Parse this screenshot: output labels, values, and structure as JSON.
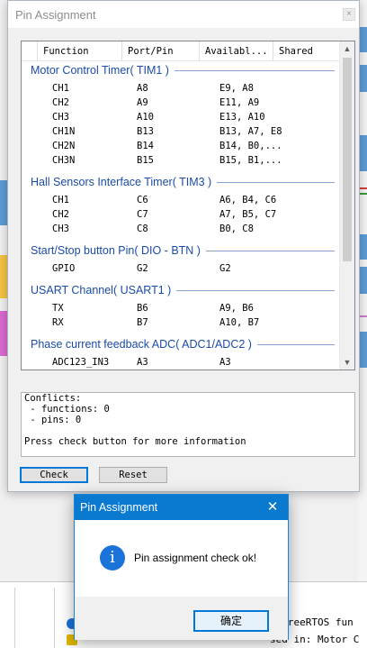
{
  "window": {
    "title": "Pin Assignment",
    "close_glyph": "×"
  },
  "columns": [
    "Function",
    "Port/Pin",
    "Availabl...",
    "Shared"
  ],
  "groups": [
    {
      "title": "Motor Control Timer( TIM1 )",
      "rows": [
        [
          "CH1",
          "A8",
          "E9, A8"
        ],
        [
          "CH2",
          "A9",
          "E11, A9"
        ],
        [
          "CH3",
          "A10",
          "E13, A10"
        ],
        [
          "CH1N",
          "B13",
          "B13, A7, E8"
        ],
        [
          "CH2N",
          "B14",
          "B14, B0,..."
        ],
        [
          "CH3N",
          "B15",
          "B15, B1,..."
        ]
      ]
    },
    {
      "title": "Hall Sensors Interface Timer( TIM3 )",
      "rows": [
        [
          "CH1",
          "C6",
          "A6, B4, C6"
        ],
        [
          "CH2",
          "C7",
          "A7, B5, C7"
        ],
        [
          "CH3",
          "C8",
          "B0, C8"
        ]
      ]
    },
    {
      "title": "Start/Stop button Pin( DIO - BTN )",
      "rows": [
        [
          "GPIO",
          "G2",
          "G2"
        ]
      ]
    },
    {
      "title": "USART Channel( USART1 )",
      "rows": [
        [
          "TX",
          "B6",
          "A9, B6"
        ],
        [
          "RX",
          "B7",
          "A10, B7"
        ]
      ]
    },
    {
      "title": "Phase current feedback ADC( ADC1/ADC2 )",
      "rows": [
        [
          "ADC123_IN3",
          "A3",
          "A3"
        ]
      ]
    }
  ],
  "conflicts": {
    "lines": [
      "Conflicts:",
      " - functions: 0",
      " - pins: 0",
      "",
      "Press check button for more information"
    ]
  },
  "buttons": {
    "check": "Check",
    "reset": "Reset"
  },
  "scrollbar": {
    "up_glyph": "▲",
    "down_glyph": "▼"
  },
  "dialog": {
    "title": "Pin Assignment",
    "close_glyph": "✕",
    "icon": "info-icon",
    "icon_glyph": "i",
    "message": "Pin assignment check ok!",
    "ok_label": "确定"
  },
  "background": {
    "log_line_1": "g FreeRTOS fun",
    "log_line_2": "sed in: Motor C"
  },
  "colors": {
    "group_title": "#1b4ba8",
    "dialog_title_bar": "#0a79d0",
    "info_icon": "#1a73d9",
    "focus_border": "#0078d7"
  }
}
